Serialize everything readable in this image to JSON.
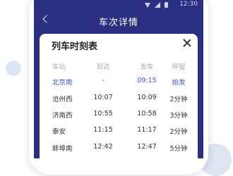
{
  "status_bar": {
    "time": "12:30"
  },
  "nav": {
    "title": "车次详情"
  },
  "dialog": {
    "title": "列车时刻表",
    "columns": [
      "车站",
      "到达",
      "发车",
      "停留"
    ],
    "rows": [
      {
        "station": "北京南",
        "arrive": "-",
        "depart": "09:15",
        "stay": "始发"
      },
      {
        "station": "沧州西",
        "arrive": "10:07",
        "depart": "10:09",
        "stay": "2分钟"
      },
      {
        "station": "济南西",
        "arrive": "10:55",
        "depart": "10:58",
        "stay": "3分钟"
      },
      {
        "station": "泰安",
        "arrive": "11:15",
        "depart": "11:17",
        "stay": "2分钟"
      },
      {
        "station": "蚌埠南",
        "arrive": "12:42",
        "depart": "12:47",
        "stay": "5分钟"
      }
    ]
  },
  "colors": {
    "nav_background": "#2a2f82",
    "highlight_text": "#3b55d6",
    "header_text": "#a7abbb",
    "body_text": "#333333"
  },
  "icons": [
    "wifi-icon",
    "signal-icon",
    "battery-icon",
    "back-icon",
    "close-icon"
  ]
}
